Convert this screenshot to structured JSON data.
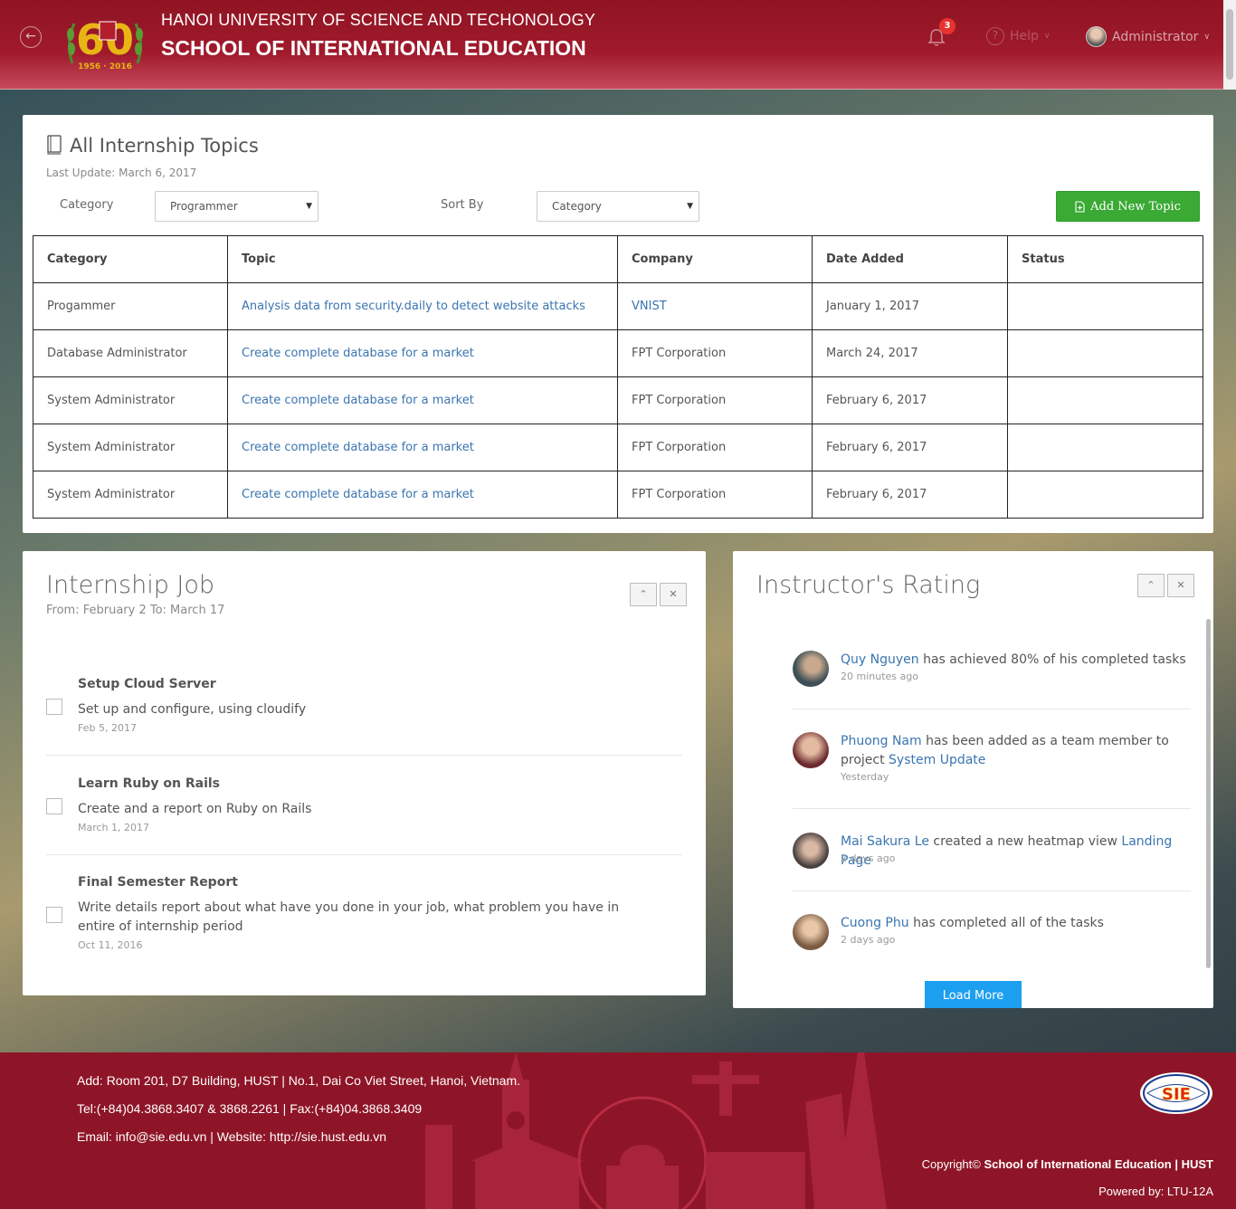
{
  "header": {
    "university": "HANOI UNIVERSITY OF SCIENCE AND TECHONOLOGY",
    "school": "SCHOOL OF INTERNATIONAL EDUCATION",
    "logo_text": "60",
    "logo_years": "1956 - 2016",
    "notification_count": "3",
    "help_label": "Help",
    "user_label": "Administrator",
    "brand_color": "#a01a2c"
  },
  "topics": {
    "title": "All Internship Topics",
    "last_update": "Last Update: March 6, 2017",
    "category_label": "Category",
    "category_value": "Programmer",
    "sort_label": "Sort By",
    "sort_value": "Category",
    "add_button": "Add New Topic",
    "columns": [
      "Category",
      "Topic",
      "Company",
      "Date Added",
      "Status"
    ],
    "rows": [
      {
        "category": "Progammer",
        "topic": "Analysis data from security.daily to detect website attacks",
        "company": "VNIST",
        "date": "January 1, 2017",
        "status": ""
      },
      {
        "category": "Database Administrator",
        "topic": "Create complete database for a market",
        "company": "FPT Corporation",
        "date": "March 24, 2017",
        "status": ""
      },
      {
        "category": "System Administrator",
        "topic": "Create complete database for a market",
        "company": "FPT Corporation",
        "date": "February 6, 2017",
        "status": ""
      },
      {
        "category": "System Administrator",
        "topic": "Create complete database for a market",
        "company": "FPT Corporation",
        "date": "February 6, 2017",
        "status": ""
      },
      {
        "category": "System Administrator",
        "topic": "Create complete database for a market",
        "company": "FPT Corporation",
        "date": "February 6, 2017",
        "status": ""
      }
    ]
  },
  "job": {
    "title": "Internship Job",
    "subtitle": "From: February 2 To: March 17",
    "tasks": [
      {
        "name": "Setup Cloud Server",
        "desc": "Set up and configure, using cloudify",
        "date": "Feb 5, 2017"
      },
      {
        "name": "Learn Ruby on Rails",
        "desc": "Create and a report on Ruby on Rails",
        "date": "March 1, 2017"
      },
      {
        "name": "Final Semester Report",
        "desc": "Write details report about what have you done in your job, what problem you have in entire of internship period",
        "date": "Oct 11, 2016"
      }
    ]
  },
  "rating": {
    "title": "Instructor's Rating",
    "feed": [
      {
        "name": "Quy Nguyen",
        "text": "has achieved 80% of his completed tasks",
        "link": "",
        "time": "20 minutes ago"
      },
      {
        "name": "Phuong Nam",
        "text": "has been added as a team member to project",
        "link": "System Update",
        "time": "Yesterday"
      },
      {
        "name": "Mai Sakura Le",
        "text": "created a new heatmap view",
        "link": "Landing Page",
        "time": "2 days ago"
      },
      {
        "name": "Cuong Phu",
        "text": "has completed all of the tasks",
        "link": "",
        "time": "2 days ago"
      }
    ],
    "load_more": "Load More"
  },
  "footer": {
    "address": "Add: Room 201, D7 Building, HUST | No.1, Dai Co Viet Street, Hanoi, Vietnam.",
    "phone": "Tel:(+84)04.3868.3407 & 3868.2261 | Fax:(+84)04.3868.3409",
    "email": "Email: info@sie.edu.vn | Website: http://sie.hust.edu.vn",
    "copyright_prefix": "Copyright© ",
    "copyright_org": "School of International Education | HUST",
    "powered": "Powered by: LTU-12A",
    "logo_text": "SIE"
  }
}
